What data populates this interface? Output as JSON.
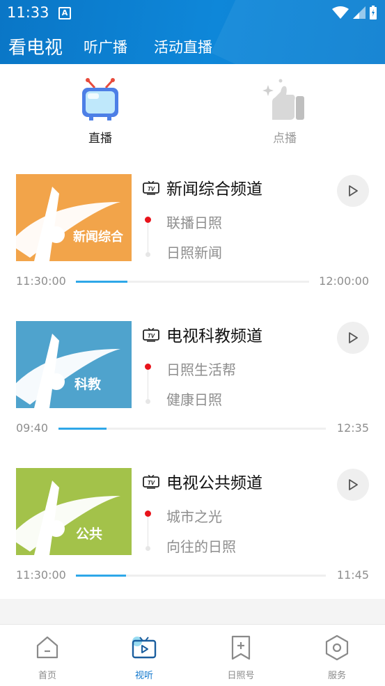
{
  "status_bar": {
    "time": "11:33",
    "notif_letter": "A"
  },
  "top_nav": {
    "tabs": [
      "看电视",
      "听广播",
      "活动直播"
    ]
  },
  "modes": {
    "live": "直播",
    "vod": "点播"
  },
  "channels": [
    {
      "name": "新闻综合频道",
      "logo_text": "新闻综合",
      "color": "#f2a44a",
      "now": "联播日照",
      "next": "日照新闻",
      "start": "11:30:00",
      "end": "12:00:00",
      "progress": 0.22
    },
    {
      "name": "电视科教频道",
      "logo_text": "科教",
      "color": "#4fa3cd",
      "now": "日照生活帮",
      "next": "健康日照",
      "start": "09:40",
      "end": "12:35",
      "progress": 0.18
    },
    {
      "name": "电视公共频道",
      "logo_text": "公共",
      "color": "#a3c24a",
      "now": "城市之光",
      "next": "向往的日照",
      "start": "11:30:00",
      "end": "11:45",
      "progress": 0.2
    }
  ],
  "bottom_nav": {
    "items": [
      "首页",
      "视听",
      "日照号",
      "服务"
    ],
    "active": "视听"
  },
  "icons": {
    "tv_badge": "TV"
  }
}
